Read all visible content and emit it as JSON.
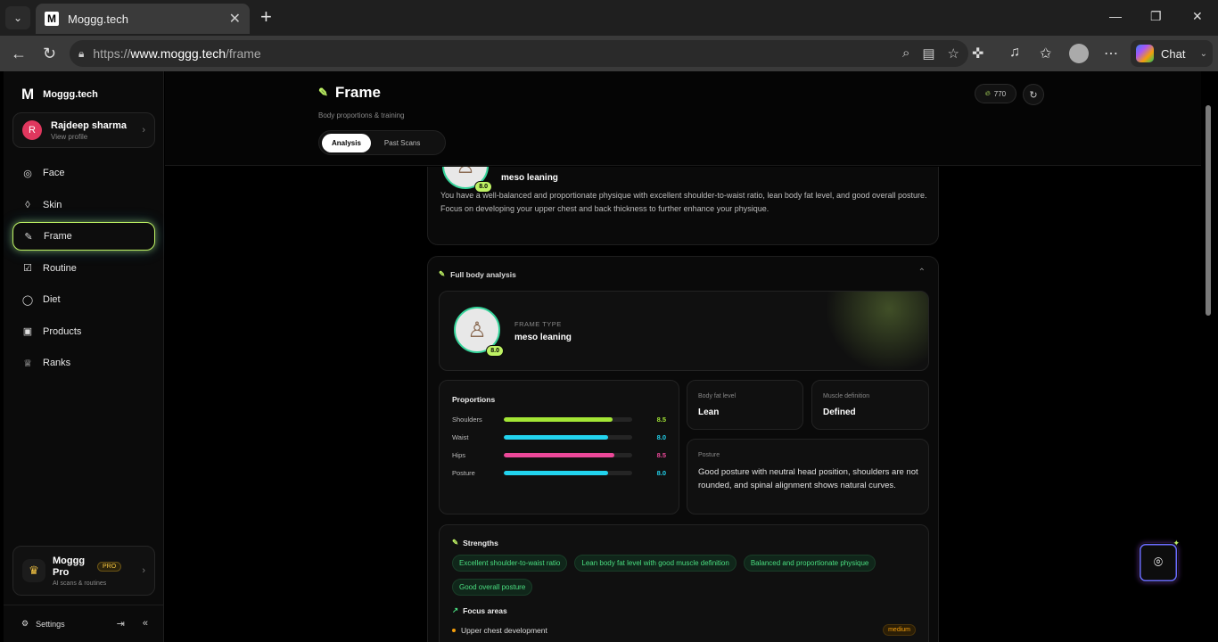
{
  "browser": {
    "tab_title": "Moggg.tech",
    "tab_favicon": "M",
    "url_prefix": "https://",
    "url_host": "www.moggg.tech",
    "url_path": "/frame",
    "chat_label": "Chat"
  },
  "sidebar": {
    "brand_logo": "M",
    "brand_name": "Moggg.tech",
    "profile": {
      "initial": "R",
      "name": "Rajdeep sharma",
      "sub": "View profile"
    },
    "items": [
      {
        "label": "Face",
        "icon": "face-scan-icon",
        "glyph": "◎"
      },
      {
        "label": "Skin",
        "icon": "droplet-icon",
        "glyph": "◊"
      },
      {
        "label": "Frame",
        "icon": "dumbbell-icon",
        "glyph": "✎"
      },
      {
        "label": "Routine",
        "icon": "checkbox-icon",
        "glyph": "☑"
      },
      {
        "label": "Diet",
        "icon": "apple-icon",
        "glyph": "◯"
      },
      {
        "label": "Products",
        "icon": "box-icon",
        "glyph": "▣"
      },
      {
        "label": "Ranks",
        "icon": "trophy-icon",
        "glyph": "♕"
      }
    ],
    "active_item": "Frame",
    "pro": {
      "title": "Moggg Pro",
      "badge": "PRO",
      "sub": "AI scans & routines"
    },
    "footer": {
      "settings": "Settings"
    }
  },
  "header": {
    "title": "Frame",
    "subtitle": "Body proportions & training",
    "tabs": [
      "Analysis",
      "Past Scans"
    ],
    "active_tab": "Analysis",
    "points": "770"
  },
  "summary": {
    "score": "8.0",
    "type": "meso leaning",
    "description": "You have a well-balanced and proportionate physique with excellent shoulder-to-waist ratio, lean body fat level, and good overall posture. Focus on developing your upper chest and back thickness to further enhance your physique."
  },
  "analysis": {
    "title": "Full body analysis",
    "frame_type_label": "FRAME TYPE",
    "frame_type": "meso leaning",
    "score": "8.0",
    "proportions_title": "Proportions",
    "proportions": [
      {
        "label": "Shoulders",
        "value": "8.5",
        "fraction": 0.85,
        "color": "#a3e635"
      },
      {
        "label": "Waist",
        "value": "8.0",
        "fraction": 0.81,
        "color": "#22d3ee"
      },
      {
        "label": "Hips",
        "value": "8.5",
        "fraction": 0.86,
        "color": "#ec4899"
      },
      {
        "label": "Posture",
        "value": "8.0",
        "fraction": 0.81,
        "color": "#22d3ee"
      }
    ],
    "body_fat_label": "Body fat level",
    "body_fat": "Lean",
    "muscle_def_label": "Muscle definition",
    "muscle_def": "Defined",
    "posture_label": "Posture",
    "posture_text": "Good posture with neutral head position, shoulders are not rounded, and spinal alignment shows natural curves.",
    "strengths_title": "Strengths",
    "strengths": [
      "Excellent shoulder-to-waist ratio",
      "Lean body fat level with good muscle definition",
      "Balanced and proportionate physique",
      "Good overall posture"
    ],
    "focus_title": "Focus areas",
    "focus_items": [
      {
        "label": "Upper chest development",
        "priority": "medium"
      }
    ]
  },
  "colors": {
    "accent": "#bef264",
    "success": "#4ade80",
    "warning": "#f59e0b"
  }
}
